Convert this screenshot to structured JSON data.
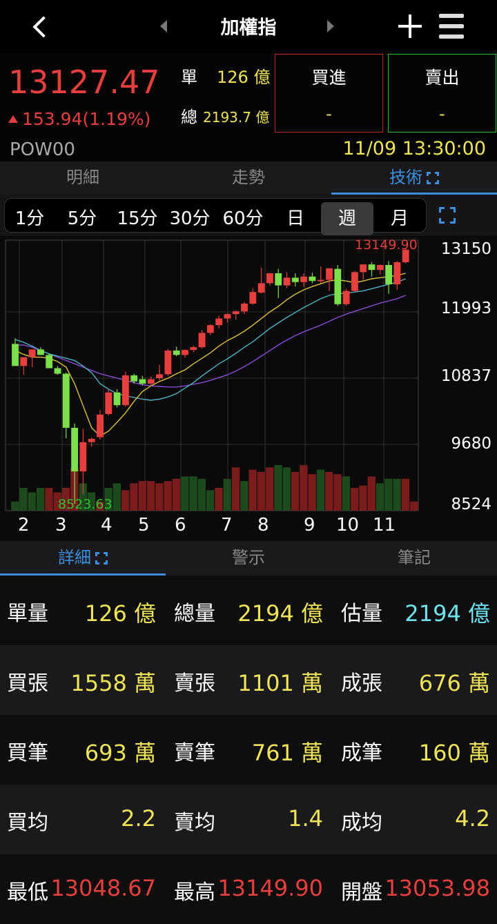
{
  "header": {
    "title": "加權指"
  },
  "quote": {
    "price": "13127.47",
    "change": "153.94(1.19%)",
    "code": "POW00",
    "unit_label": "單",
    "unit_value": "126 億",
    "total_label": "總",
    "total_value": "2193.7 億",
    "buy_label": "買進",
    "buy_value": "-",
    "sell_label": "賣出",
    "sell_value": "-",
    "datetime": "11/09 13:30:00",
    "up_color": "#e83e3e",
    "down_color": "#2ec02e"
  },
  "tabs_top": [
    {
      "label": "明細"
    },
    {
      "label": "走勢"
    },
    {
      "label": "技術"
    }
  ],
  "periods": [
    "1分",
    "5分",
    "15分",
    "30分",
    "60分",
    "日",
    "週",
    "月"
  ],
  "active_period": "週",
  "chart_data": {
    "type": "candlestick",
    "ylim": [
      8524,
      13150
    ],
    "y_ticks": [
      "13150",
      "11993",
      "10837",
      "9680",
      "8524"
    ],
    "x_ticks": [
      "2",
      "3",
      "4",
      "5",
      "6",
      "7",
      "8",
      "9",
      "10",
      "11"
    ],
    "high_annotation": "13149.90",
    "low_annotation": "8523.63",
    "candles": [
      {
        "o": 11420,
        "h": 11520,
        "l": 11260,
        "c": 11020
      },
      {
        "o": 11020,
        "h": 11160,
        "l": 10860,
        "c": 11180
      },
      {
        "o": 11180,
        "h": 11320,
        "l": 11000,
        "c": 11320
      },
      {
        "o": 11320,
        "h": 11360,
        "l": 11220,
        "c": 11220
      },
      {
        "o": 11220,
        "h": 11240,
        "l": 10990,
        "c": 10980
      },
      {
        "o": 10980,
        "h": 11020,
        "l": 10860,
        "c": 10880
      },
      {
        "o": 10880,
        "h": 10900,
        "l": 9710,
        "c": 9900
      },
      {
        "o": 9900,
        "h": 9980,
        "l": 8524,
        "c": 9110
      },
      {
        "o": 9110,
        "h": 9880,
        "l": 8700,
        "c": 9640
      },
      {
        "o": 9640,
        "h": 9720,
        "l": 9560,
        "c": 9700
      },
      {
        "o": 9730,
        "h": 10220,
        "l": 9690,
        "c": 10140
      },
      {
        "o": 10150,
        "h": 10590,
        "l": 10120,
        "c": 10540
      },
      {
        "o": 10540,
        "h": 10600,
        "l": 10270,
        "c": 10310
      },
      {
        "o": 10310,
        "h": 10920,
        "l": 10280,
        "c": 10850
      },
      {
        "o": 10850,
        "h": 10880,
        "l": 10700,
        "c": 10740
      },
      {
        "o": 10780,
        "h": 10840,
        "l": 10670,
        "c": 10700
      },
      {
        "o": 10700,
        "h": 10830,
        "l": 10650,
        "c": 10780
      },
      {
        "o": 10800,
        "h": 11040,
        "l": 10760,
        "c": 10870
      },
      {
        "o": 10870,
        "h": 11330,
        "l": 10840,
        "c": 11300
      },
      {
        "o": 11300,
        "h": 11370,
        "l": 11200,
        "c": 11220
      },
      {
        "o": 11220,
        "h": 11320,
        "l": 11170,
        "c": 11310
      },
      {
        "o": 11310,
        "h": 11390,
        "l": 11270,
        "c": 11360
      },
      {
        "o": 11360,
        "h": 11670,
        "l": 11340,
        "c": 11620
      },
      {
        "o": 11620,
        "h": 11780,
        "l": 11580,
        "c": 11760
      },
      {
        "o": 11760,
        "h": 11930,
        "l": 11700,
        "c": 11880
      },
      {
        "o": 11880,
        "h": 11970,
        "l": 11810,
        "c": 11960
      },
      {
        "o": 11960,
        "h": 12030,
        "l": 11860,
        "c": 12010
      },
      {
        "o": 12010,
        "h": 12180,
        "l": 11960,
        "c": 12150
      },
      {
        "o": 12150,
        "h": 12420,
        "l": 12130,
        "c": 12360
      },
      {
        "o": 12350,
        "h": 12800,
        "l": 12330,
        "c": 12520
      },
      {
        "o": 12520,
        "h": 12680,
        "l": 12480,
        "c": 12700
      },
      {
        "o": 12700,
        "h": 12780,
        "l": 12250,
        "c": 12480
      },
      {
        "o": 12480,
        "h": 12720,
        "l": 12430,
        "c": 12620
      },
      {
        "o": 12620,
        "h": 12700,
        "l": 12460,
        "c": 12540
      },
      {
        "o": 12540,
        "h": 12700,
        "l": 12450,
        "c": 12640
      },
      {
        "o": 12640,
        "h": 12710,
        "l": 12520,
        "c": 12560
      },
      {
        "o": 12560,
        "h": 12820,
        "l": 12520,
        "c": 12580
      },
      {
        "o": 12580,
        "h": 12780,
        "l": 12380,
        "c": 12790
      },
      {
        "o": 12780,
        "h": 12850,
        "l": 12110,
        "c": 12140
      },
      {
        "o": 12140,
        "h": 12420,
        "l": 12110,
        "c": 12380
      },
      {
        "o": 12380,
        "h": 12740,
        "l": 12360,
        "c": 12720
      },
      {
        "o": 12720,
        "h": 12860,
        "l": 12580,
        "c": 12860
      },
      {
        "o": 12860,
        "h": 12900,
        "l": 12640,
        "c": 12760
      },
      {
        "o": 12760,
        "h": 12860,
        "l": 12680,
        "c": 12850
      },
      {
        "o": 12850,
        "h": 12920,
        "l": 12330,
        "c": 12500
      },
      {
        "o": 12500,
        "h": 12920,
        "l": 12400,
        "c": 12900
      },
      {
        "o": 12900,
        "h": 13149.9,
        "l": 12880,
        "c": 13127.47
      }
    ],
    "ma_fast": [
      11300,
      11230,
      11180,
      11180,
      11160,
      11100,
      11000,
      10700,
      10300,
      9900,
      9750,
      9840,
      10000,
      10170,
      10380,
      10560,
      10660,
      10740,
      10800,
      10880,
      10950,
      11060,
      11160,
      11260,
      11380,
      11480,
      11560,
      11650,
      11760,
      11880,
      12000,
      12100,
      12220,
      12320,
      12400,
      12460,
      12510,
      12560,
      12580,
      12560,
      12530,
      12560,
      12600,
      12620,
      12640,
      12660,
      12700
    ],
    "ma_mid": [
      11500,
      11450,
      11380,
      11300,
      11240,
      11200,
      11160,
      11120,
      11020,
      10900,
      10700,
      10600,
      10520,
      10480,
      10450,
      10420,
      10400,
      10420,
      10460,
      10520,
      10620,
      10720,
      10840,
      10950,
      11060,
      11150,
      11250,
      11360,
      11460,
      11580,
      11700,
      11800,
      11900,
      11990,
      12080,
      12160,
      12240,
      12300,
      12330,
      12340,
      12360,
      12380,
      12420,
      12460,
      12500,
      12540,
      12600
    ],
    "ma_slow": [
      11400,
      11400,
      11360,
      11300,
      11240,
      11180,
      11120,
      11060,
      11000,
      10940,
      10880,
      10840,
      10800,
      10760,
      10720,
      10680,
      10660,
      10650,
      10640,
      10640,
      10660,
      10690,
      10720,
      10760,
      10810,
      10860,
      10930,
      11010,
      11100,
      11200,
      11300,
      11400,
      11490,
      11570,
      11640,
      11700,
      11760,
      11830,
      11900,
      11960,
      12010,
      12060,
      12110,
      12160,
      12200,
      12240,
      12300
    ],
    "volume": [
      0.2,
      0.5,
      0.4,
      0.5,
      0.5,
      0.4,
      0.5,
      0.95,
      0.6,
      0.4,
      0.2,
      0.5,
      0.6,
      0.45,
      0.6,
      0.65,
      0.65,
      0.6,
      0.65,
      0.7,
      0.75,
      0.75,
      0.7,
      0.45,
      0.5,
      0.7,
      0.95,
      0.65,
      0.9,
      0.85,
      0.95,
      1.0,
      0.95,
      0.85,
      1.0,
      0.8,
      0.9,
      0.85,
      0.8,
      0.75,
      0.5,
      0.55,
      0.75,
      0.6,
      0.7,
      0.7,
      0.7,
      0.2
    ],
    "volume_up": [
      false,
      false,
      false,
      false,
      true,
      true,
      true,
      true,
      false,
      false,
      true,
      false,
      false,
      true,
      true,
      true,
      true,
      true,
      true,
      true,
      false,
      false,
      false,
      false,
      true,
      false,
      true,
      false,
      true,
      true,
      true,
      false,
      false,
      true,
      true,
      true,
      false,
      true,
      true,
      false,
      true,
      true,
      true,
      false,
      false,
      false,
      true,
      true
    ]
  },
  "tabs_bottom": [
    {
      "label": "詳細"
    },
    {
      "label": "警示"
    },
    {
      "label": "筆記"
    }
  ],
  "details": [
    [
      {
        "label": "單量",
        "value": "126 億",
        "color": "yellow"
      },
      {
        "label": "總量",
        "value": "2194 億",
        "color": "yellow"
      },
      {
        "label": "估量",
        "value": "2194 億",
        "color": "cyan"
      }
    ],
    [
      {
        "label": "買張",
        "value": "1558 萬",
        "color": "yellow"
      },
      {
        "label": "賣張",
        "value": "1101 萬",
        "color": "yellow"
      },
      {
        "label": "成張",
        "value": "676 萬",
        "color": "yellow"
      }
    ],
    [
      {
        "label": "買筆",
        "value": "693 萬",
        "color": "yellow"
      },
      {
        "label": "賣筆",
        "value": "761 萬",
        "color": "yellow"
      },
      {
        "label": "成筆",
        "value": "160 萬",
        "color": "yellow"
      }
    ],
    [
      {
        "label": "買均",
        "value": "2.2",
        "color": "yellow"
      },
      {
        "label": "賣均",
        "value": "1.4",
        "color": "yellow"
      },
      {
        "label": "成均",
        "value": "4.2",
        "color": "yellow"
      }
    ],
    [
      {
        "label": "最低",
        "value": "13048.67",
        "color": "red"
      },
      {
        "label": "最高",
        "value": "13149.90",
        "color": "red"
      },
      {
        "label": "開盤",
        "value": "13053.98",
        "color": "red"
      }
    ]
  ]
}
